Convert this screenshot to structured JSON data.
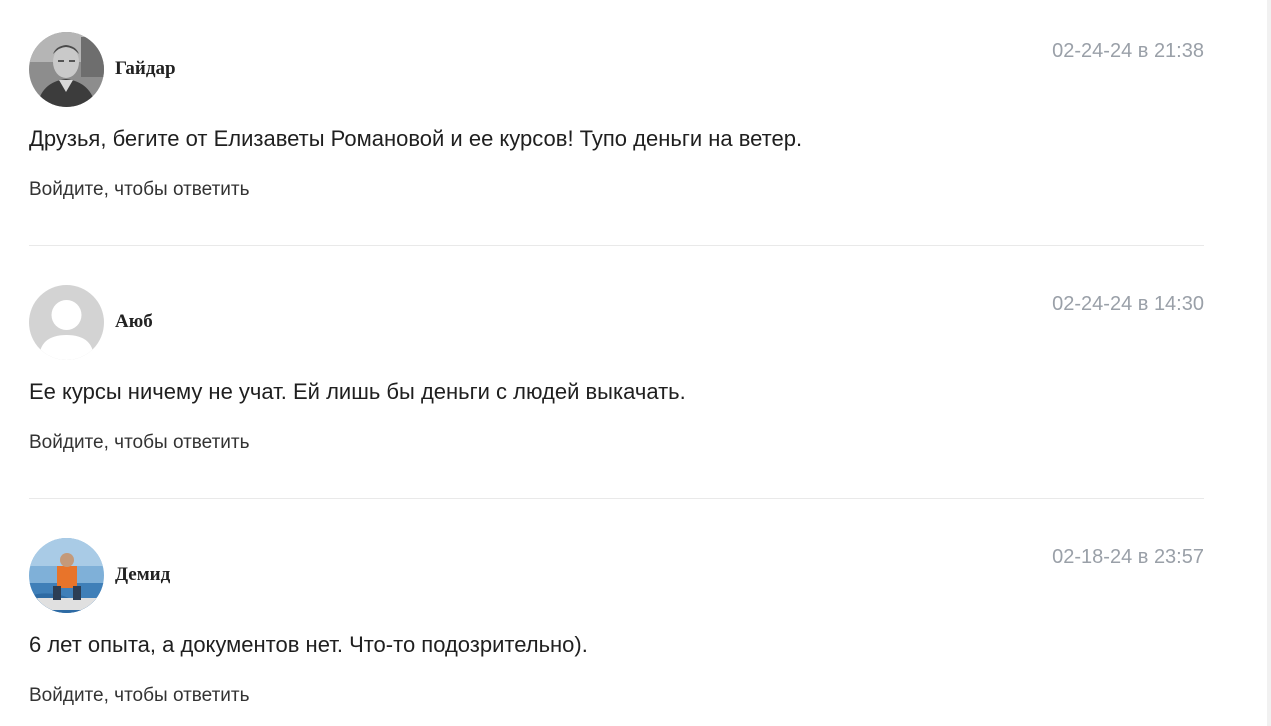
{
  "comments": [
    {
      "author": "Гайдар",
      "timestamp": "02-24-24 в 21:38",
      "text": "Друзья, бегите от Елизаветы Романовой и ее курсов! Тупо деньги на ветер.",
      "reply_label": "Войдите, чтобы ответить",
      "avatar": "user-photo-avatar"
    },
    {
      "author": "Аюб",
      "timestamp": "02-24-24 в 14:30",
      "text": "Ее курсы ничему не учат. Ей лишь бы деньги с людей выкачать.",
      "reply_label": "Войдите, чтобы ответить",
      "avatar": "default-user-avatar"
    },
    {
      "author": "Демид",
      "timestamp": "02-18-24 в 23:57",
      "text": "6 лет опыта, а документов нет. Что-то подозрительно).",
      "reply_label": "Войдите, чтобы ответить",
      "avatar": "user-photo-avatar"
    }
  ],
  "colors": {
    "timestamp": "#9aa0a8",
    "divider": "#e9e9e9",
    "default_avatar_bg": "#d3d3d3"
  }
}
